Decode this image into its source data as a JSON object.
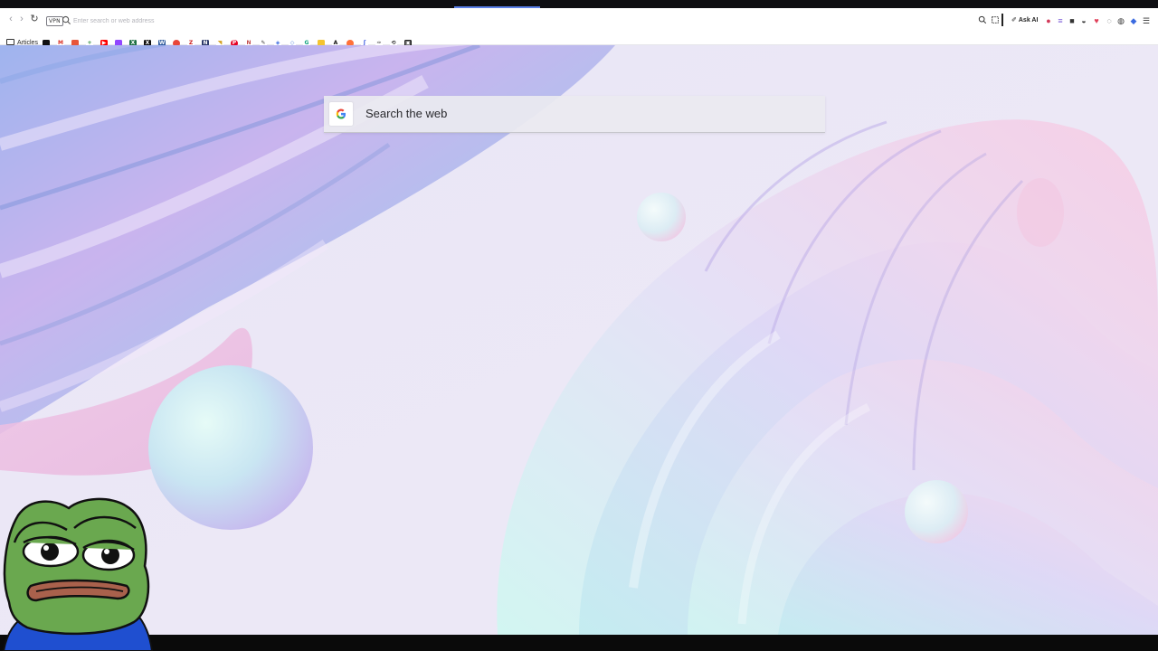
{
  "browser": {
    "vpn_label": "VPN",
    "address_placeholder": "Enter search or web address",
    "ask_ai_label": "Ask AI",
    "accent_tab_color": "#5a7fe8"
  },
  "bookmarks": {
    "folder_label": "Articles",
    "items": [
      {
        "icon": "notion-icon"
      },
      {
        "icon": "gmail-icon"
      },
      {
        "icon": "google-maps-icon"
      },
      {
        "icon": "add-icon"
      },
      {
        "icon": "youtube-icon"
      },
      {
        "icon": "twitch-icon"
      },
      {
        "icon": "excel-icon"
      },
      {
        "icon": "x-icon"
      },
      {
        "icon": "word-icon"
      },
      {
        "icon": "app-icon"
      },
      {
        "icon": "zotero-icon"
      },
      {
        "icon": "notion-n-icon"
      },
      {
        "icon": "bookmark-icon"
      },
      {
        "icon": "pinterest-icon"
      },
      {
        "icon": "extension-icon"
      },
      {
        "icon": "edit-icon"
      },
      {
        "icon": "arrow-icon"
      },
      {
        "icon": "link-icon"
      },
      {
        "icon": "chatgpt-icon"
      },
      {
        "icon": "keep-icon"
      },
      {
        "icon": "anthropic-icon"
      },
      {
        "icon": "firefox-icon"
      },
      {
        "icon": "feather-icon"
      },
      {
        "icon": "pen-icon"
      },
      {
        "icon": "refresh-icon"
      },
      {
        "icon": "terminal-icon"
      }
    ]
  },
  "newtab": {
    "search_placeholder": "Search the web",
    "search_engine_icon": "google-icon"
  },
  "overlay": {
    "sticker": "pepe-frog-sticker"
  }
}
